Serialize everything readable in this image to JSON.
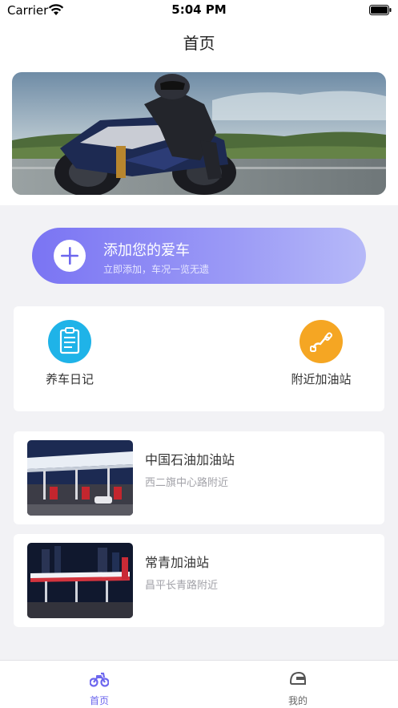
{
  "status_bar": {
    "carrier": "Carrier",
    "time": "5:04 PM"
  },
  "nav": {
    "title": "首页"
  },
  "add_car": {
    "title": "添加您的爱车",
    "subtitle": "立即添加，车况一览无遗"
  },
  "quick_actions": [
    {
      "label": "养车日记",
      "icon": "clipboard-icon",
      "color": "#1fb3e8"
    },
    {
      "label": "附近加油站",
      "icon": "fuel-nozzle-icon",
      "color": "#f5a623"
    }
  ],
  "stations": [
    {
      "name": "中国石油加油站",
      "address": "西二旗中心路附近"
    },
    {
      "name": "常青加油站",
      "address": "昌平长青路附近"
    }
  ],
  "tabs": [
    {
      "label": "首页",
      "icon": "motorcycle-icon",
      "active": true
    },
    {
      "label": "我的",
      "icon": "helmet-icon",
      "active": false
    }
  ],
  "colors": {
    "accent": "#6d67ee",
    "tab_inactive": "#666666",
    "add_gradient_start": "#7a74f3",
    "add_gradient_end": "#b6b9f8"
  }
}
